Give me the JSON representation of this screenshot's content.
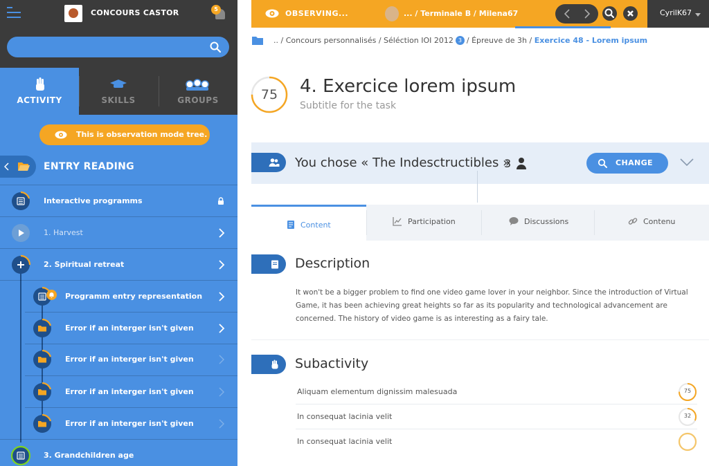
{
  "app": {
    "title": "CONCOURS CASTOR",
    "notifications": "5"
  },
  "search": {
    "placeholder": ""
  },
  "left_tabs": [
    {
      "label": "ACTIVITY"
    },
    {
      "label": "SKILLS"
    },
    {
      "label": "GROUPS"
    }
  ],
  "observation_notice": "This is observation mode tree.",
  "entry": {
    "title": "ENTRY READING"
  },
  "tree": [
    {
      "label": "Interactive programms"
    },
    {
      "label": "1. Harvest"
    },
    {
      "label": "2. Spiritual retreat"
    },
    {
      "label": "Programm entry representation"
    },
    {
      "label": "Error if an interger isn't given"
    },
    {
      "label": "Error if an interger isn't given"
    },
    {
      "label": "Error if an interger isn't given"
    },
    {
      "label": "Error if an interger isn't given"
    },
    {
      "label": "3. Grandchildren age"
    }
  ],
  "observe_bar": {
    "label": "OBSERVING...",
    "path": "... / Terminale B / ",
    "user": "Milena67"
  },
  "user": {
    "name": "CyrilK67"
  },
  "breadcrumb": {
    "items": [
      ".. ",
      "/ Concours personnalisés ",
      "/ Séléction IOI 2012"
    ],
    "badge": "3",
    "after_badge": "/ Épreuve de 3h /",
    "current": "Exercice 48 - Lorem ipsum"
  },
  "task": {
    "score": "75",
    "score_fraction": 0.75,
    "title": "4. Exercice lorem ipsum",
    "subtitle": "Subtitle for the task"
  },
  "team": {
    "text": "You chose « The Indesctructibles »",
    "count": "3",
    "change_label": "CHANGE"
  },
  "content_tabs": [
    {
      "label": "Content"
    },
    {
      "label": "Participation"
    },
    {
      "label": "Discussions"
    },
    {
      "label": "Contenu"
    }
  ],
  "description": {
    "title": "Description",
    "text": "It won't be a bigger problem to find one video game lover in your neighbor. Since the introduction of Virtual Game, it has been achieving great heights so far as its popularity and technological advancement are concerned. The history of video game is as interesting as a fairy tale."
  },
  "subactivity": {
    "title": "Subactivity",
    "items": [
      {
        "label": "Aliquam elementum dignissim malesuada",
        "score": "75",
        "fraction": 0.75
      },
      {
        "label": "In consequat lacinia velit",
        "score": "32",
        "fraction": 0.32
      },
      {
        "label": "In consequat lacinia velit",
        "score": "",
        "fraction": 1.0
      }
    ]
  },
  "colors": {
    "primary": "#4a90e2",
    "dark_blue": "#2e6fba",
    "accent": "#f5a623",
    "dark": "#3b3b3b"
  }
}
